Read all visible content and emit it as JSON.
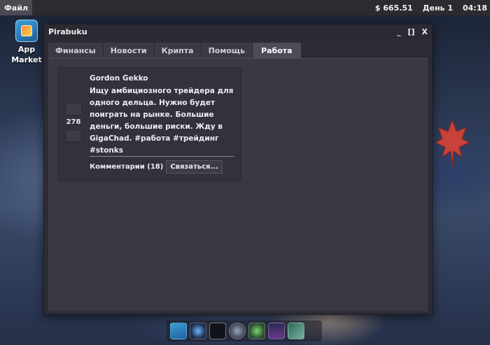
{
  "topbar": {
    "file_menu": "Файл",
    "balance": "$ 665.51",
    "day": "День 1",
    "time": "04:18"
  },
  "desktop": {
    "app_market": {
      "label_line1": "App",
      "label_line2": "Market",
      "icon": "shopping-bag-icon"
    }
  },
  "window": {
    "title": "Pirabuku",
    "controls": {
      "minimize": "_",
      "maximize": "[]",
      "close": "X"
    },
    "tabs": [
      {
        "label": "Финансы"
      },
      {
        "label": "Новости"
      },
      {
        "label": "Крипта"
      },
      {
        "label": "Помощь"
      },
      {
        "label": "Работа",
        "active": true
      }
    ],
    "post": {
      "author": "Gordon Gekko",
      "text": "Ищу амбициозного трейдера для одного дельца. Нужно будет поиграть на рынке. Большие деньги, большие риски. Жду в GigaChad. #работа #трейдинг #stonks",
      "votes": "278",
      "comments": "Комментарии (18)",
      "contact_button": "Связаться..."
    }
  },
  "dock": {
    "items": [
      "app-market-icon",
      "network-icon",
      "terminal-icon",
      "settings-icon",
      "chat-icon",
      "stock-chart-icon",
      "trading-icon"
    ]
  },
  "colors": {
    "window_bg": "#2d2c35",
    "content_bg": "#3a3943",
    "tab_active": "#4d4c58",
    "topbar_bg": "#2b2b30"
  }
}
